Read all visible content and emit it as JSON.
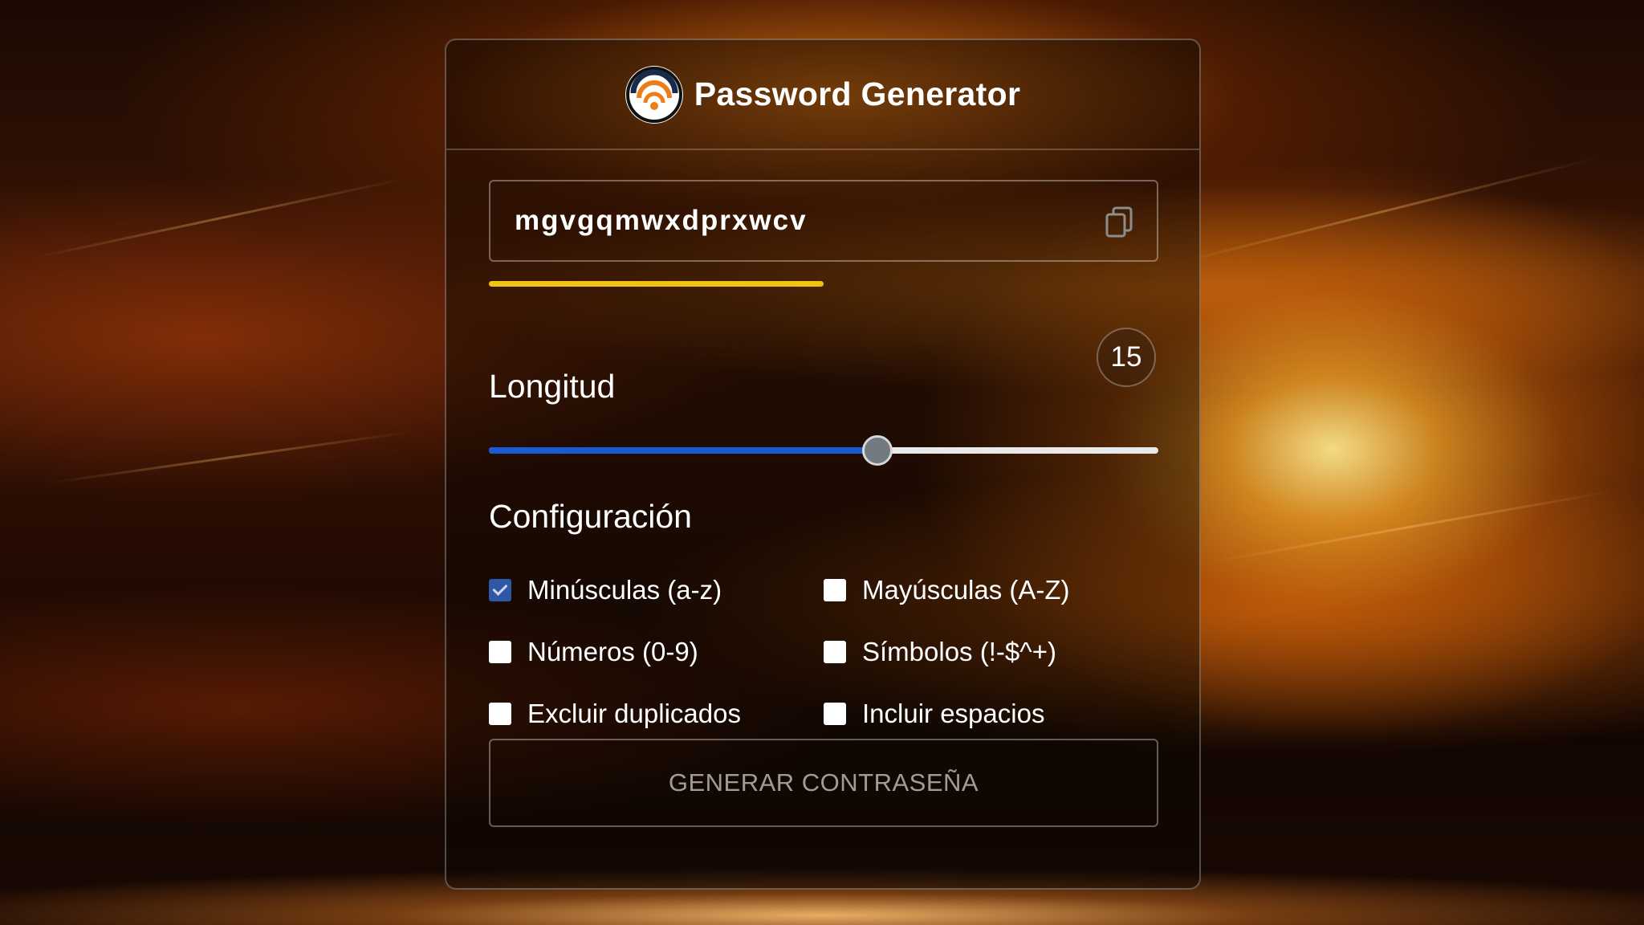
{
  "header": {
    "title": "Password Generator",
    "logo_icon": "generator-logo-icon"
  },
  "password": {
    "value": "mgvgqmwxdprxwcv",
    "copy_icon": "copy-icon",
    "strength_fraction": 0.5,
    "strength_color": "#f2c311"
  },
  "length": {
    "label": "Longitud",
    "value": "15",
    "slider_fraction": 0.58,
    "accent": "#1b5ad6"
  },
  "config": {
    "label": "Configuración",
    "options": [
      {
        "label": "Minúsculas (a-z)",
        "checked": true
      },
      {
        "label": "Mayúsculas (A-Z)",
        "checked": false
      },
      {
        "label": "Números (0-9)",
        "checked": false
      },
      {
        "label": "Símbolos (!-$^+)",
        "checked": false
      },
      {
        "label": "Excluir duplicados",
        "checked": false
      },
      {
        "label": "Incluir espacios",
        "checked": false
      }
    ]
  },
  "actions": {
    "generate_label": "GENERAR CONTRASEÑA"
  }
}
